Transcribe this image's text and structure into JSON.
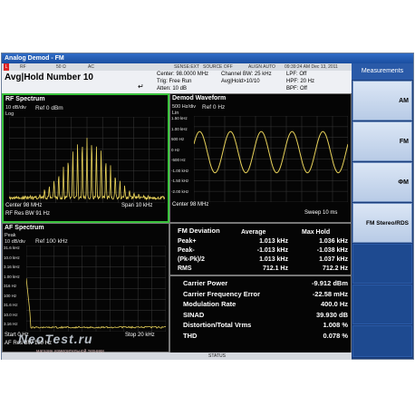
{
  "window": {
    "title": "Analog Demod - FM"
  },
  "status_row": {
    "items": [
      "L",
      "RF",
      "50 Ω",
      "AC",
      "SENSE:EXT",
      "SOURCE OFF",
      "ALIGN AUTO",
      "09:39:24 AM Dec 13, 2011"
    ]
  },
  "header": {
    "title": "Avg|Hold Number 10",
    "center": "Center: 98.0000 MHz",
    "trig": "Trig: Free Run",
    "atten": "Atten: 10 dB",
    "channel_bw": "Channel BW: 25 kHz",
    "avg_hold": "Avg|Hold>10/10",
    "lpf": "LPF: Off",
    "hpf": "HPF: 20 Hz",
    "bpf": "BPF: Off"
  },
  "rf_spectrum": {
    "title": "RF Spectrum",
    "scale": "10 dB/div",
    "ref": "Ref 0 dBm",
    "mode": "Log",
    "center": "Center  98 MHz",
    "span": "Span 10 kHz",
    "res_bw": "RF Res BW  91 Hz",
    "trace_color": "#e8d25a"
  },
  "demod_waveform": {
    "title": "Demod Waveform",
    "scale": "500 Hz/div",
    "ref": "Ref 0 Hz",
    "mode": "Lin",
    "y_ticks": [
      "1.50 kHz",
      "1.00 kHz",
      "500 Hz",
      "0 Hz",
      "-500 Hz",
      "-1.00 kHz",
      "-1.50 kHz",
      "-2.00 kHz"
    ],
    "center": "Center  98 MHz",
    "sweep": "Sweep  10 ms",
    "trace_color": "#e8d25a"
  },
  "af_spectrum": {
    "title": "AF Spectrum",
    "mode": "Peak",
    "scale": "10 dB/div",
    "ref": "Ref 100 kHz",
    "y_ticks": [
      "31.6 kHz",
      "10.0 kHz",
      "3.16 kHz",
      "1.00 kHz",
      "316 Hz",
      "100 Hz",
      "31.6 Hz",
      "10.0 Hz",
      "3.16 Hz"
    ],
    "start": "Start  0 Hz",
    "stop": "Stop 20 kHz",
    "res_bw": "AF Res BW  180 Hz",
    "trace_color": "#e8d25a"
  },
  "fm_deviation": {
    "title": "FM Deviation",
    "columns": [
      "Average",
      "Max Hold"
    ],
    "rows": [
      {
        "label": "Peak+",
        "avg": "1.013 kHz",
        "max": "1.036 kHz"
      },
      {
        "label": "Peak-",
        "avg": "-1.013 kHz",
        "max": "-1.038 kHz"
      },
      {
        "label": "(Pk-Pk)/2",
        "avg": "1.013 kHz",
        "max": "1.037 kHz"
      },
      {
        "label": "RMS",
        "avg": "712.1 Hz",
        "max": "712.2 Hz"
      }
    ]
  },
  "measurements": [
    {
      "label": "Carrier Power",
      "value": "-9.912 dBm"
    },
    {
      "label": "Carrier Frequency Error",
      "value": "-22.58 mHz"
    },
    {
      "label": "Modulation Rate",
      "value": "400.0 Hz"
    },
    {
      "label": "SINAD",
      "value": "39.930 dB"
    },
    {
      "label": "Distortion/Total Vrms",
      "value": "1.008 %"
    },
    {
      "label": "THD",
      "value": "0.078 %"
    }
  ],
  "menu": {
    "title": "Measurements",
    "items": [
      "AM",
      "FM",
      "ΦM",
      "FM Stereo/RDS"
    ]
  },
  "bottom_bar": {
    "status": "STATUS"
  },
  "watermark": {
    "text": "NeoTest.ru",
    "subtitle": "магазин измерительной техники"
  }
}
